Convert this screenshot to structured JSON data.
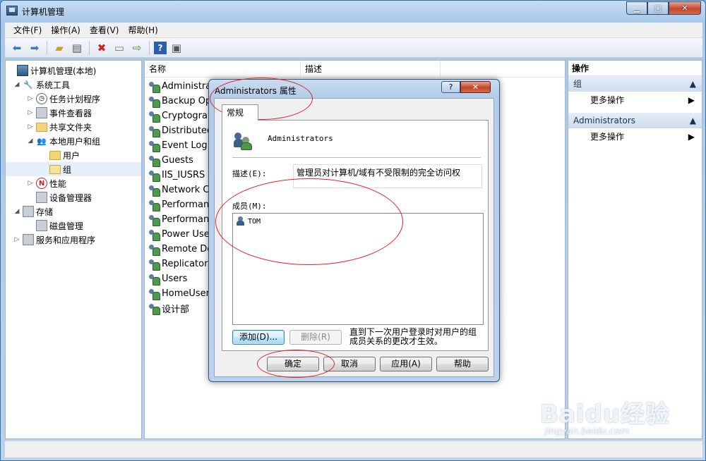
{
  "window": {
    "title": "计算机管理",
    "min": "▁",
    "max": "▢",
    "close": "✕"
  },
  "menu": [
    "文件(F)",
    "操作(A)",
    "查看(V)",
    "帮助(H)"
  ],
  "toolbar": [
    "back-icon",
    "forward-icon",
    "up-folder-icon",
    "show-tree-icon",
    "delete-icon",
    "properties-icon",
    "export-icon",
    "help-icon",
    "console-icon"
  ],
  "tree": [
    {
      "label": "计算机管理(本地)",
      "level": 0,
      "exp": "",
      "icon": "computer"
    },
    {
      "label": "系统工具",
      "level": 1,
      "exp": "◢",
      "icon": "tools"
    },
    {
      "label": "任务计划程序",
      "level": 2,
      "exp": "▷",
      "icon": "clock"
    },
    {
      "label": "事件查看器",
      "level": 2,
      "exp": "▷",
      "icon": "event"
    },
    {
      "label": "共享文件夹",
      "level": 2,
      "exp": "▷",
      "icon": "share"
    },
    {
      "label": "本地用户和组",
      "level": 2,
      "exp": "◢",
      "icon": "users"
    },
    {
      "label": "用户",
      "level": 3,
      "exp": "",
      "icon": "folder"
    },
    {
      "label": "组",
      "level": 3,
      "exp": "",
      "icon": "folder-sel"
    },
    {
      "label": "性能",
      "level": 2,
      "exp": "▷",
      "icon": "perf"
    },
    {
      "label": "设备管理器",
      "level": 2,
      "exp": "",
      "icon": "device"
    },
    {
      "label": "存储",
      "level": 1,
      "exp": "◢",
      "icon": "storage"
    },
    {
      "label": "磁盘管理",
      "level": 2,
      "exp": "",
      "icon": "disk"
    },
    {
      "label": "服务和应用程序",
      "level": 1,
      "exp": "▷",
      "icon": "services"
    }
  ],
  "list": {
    "headers": [
      "名称",
      "描述"
    ],
    "rows": [
      "Administrat",
      "Backup Ope",
      "Cryptograp",
      "Distributed",
      "Event Log R",
      "Guests",
      "IIS_IUSRS",
      "Network Co",
      "Performanc",
      "Performanc",
      "Power User",
      "Remote Des",
      "Replicator",
      "Users",
      "HomeUsers",
      "设计部"
    ]
  },
  "actions": {
    "title": "操作",
    "sections": [
      {
        "name": "组",
        "item": "更多操作"
      },
      {
        "name": "Administrators",
        "item": "更多操作"
      }
    ]
  },
  "dialog": {
    "title": "Administrators 属性",
    "help_btn": "?",
    "close_btn": "✕",
    "tab": "常规",
    "group_name": "Administrators",
    "desc_label": "描述(E):",
    "desc_value": "管理员对计算机/域有不受限制的完全访问权",
    "members_label": "成员(M):",
    "members": [
      "TOM"
    ],
    "add_btn": "添加(D)...",
    "remove_btn": "删除(R)",
    "note": "直到下一次用户登录时对用户的组成员关系的更改才生效。",
    "ok_btn": "确定",
    "cancel_btn": "取消",
    "apply_btn": "应用(A)",
    "help_label": "帮助"
  },
  "watermark": {
    "main": "Baidu经验",
    "sub": "jingyan.baidu.com"
  }
}
